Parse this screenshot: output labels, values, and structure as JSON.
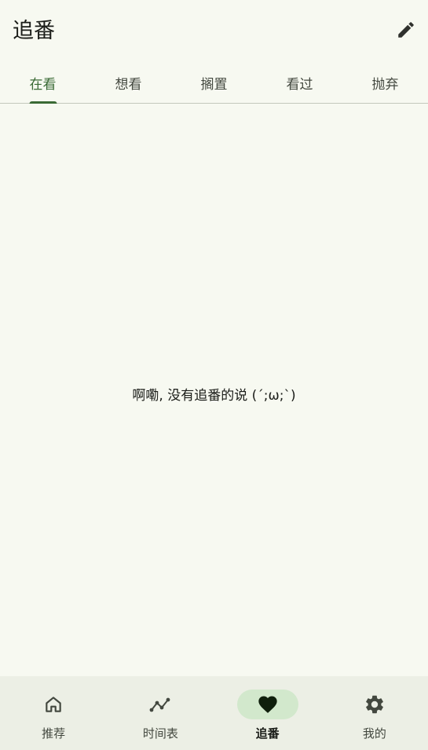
{
  "header": {
    "title": "追番",
    "edit_icon": "pencil-icon"
  },
  "tabs": [
    {
      "label": "在看",
      "active": true
    },
    {
      "label": "想看",
      "active": false
    },
    {
      "label": "搁置",
      "active": false
    },
    {
      "label": "看过",
      "active": false
    },
    {
      "label": "抛弃",
      "active": false
    }
  ],
  "empty_state": {
    "message": "啊嘞, 没有追番的说 (´;ω;`)"
  },
  "bottom_nav": {
    "items": [
      {
        "label": "推荐",
        "icon": "home-icon",
        "active": false
      },
      {
        "label": "时间表",
        "icon": "timeline-icon",
        "active": false
      },
      {
        "label": "追番",
        "icon": "heart-icon",
        "active": true
      },
      {
        "label": "我的",
        "icon": "gear-icon",
        "active": false
      }
    ]
  },
  "colors": {
    "background": "#f7f9f1",
    "accent": "#3a6a35",
    "nav_background": "#ecefe5",
    "nav_active_pill": "#d2e8cc"
  }
}
